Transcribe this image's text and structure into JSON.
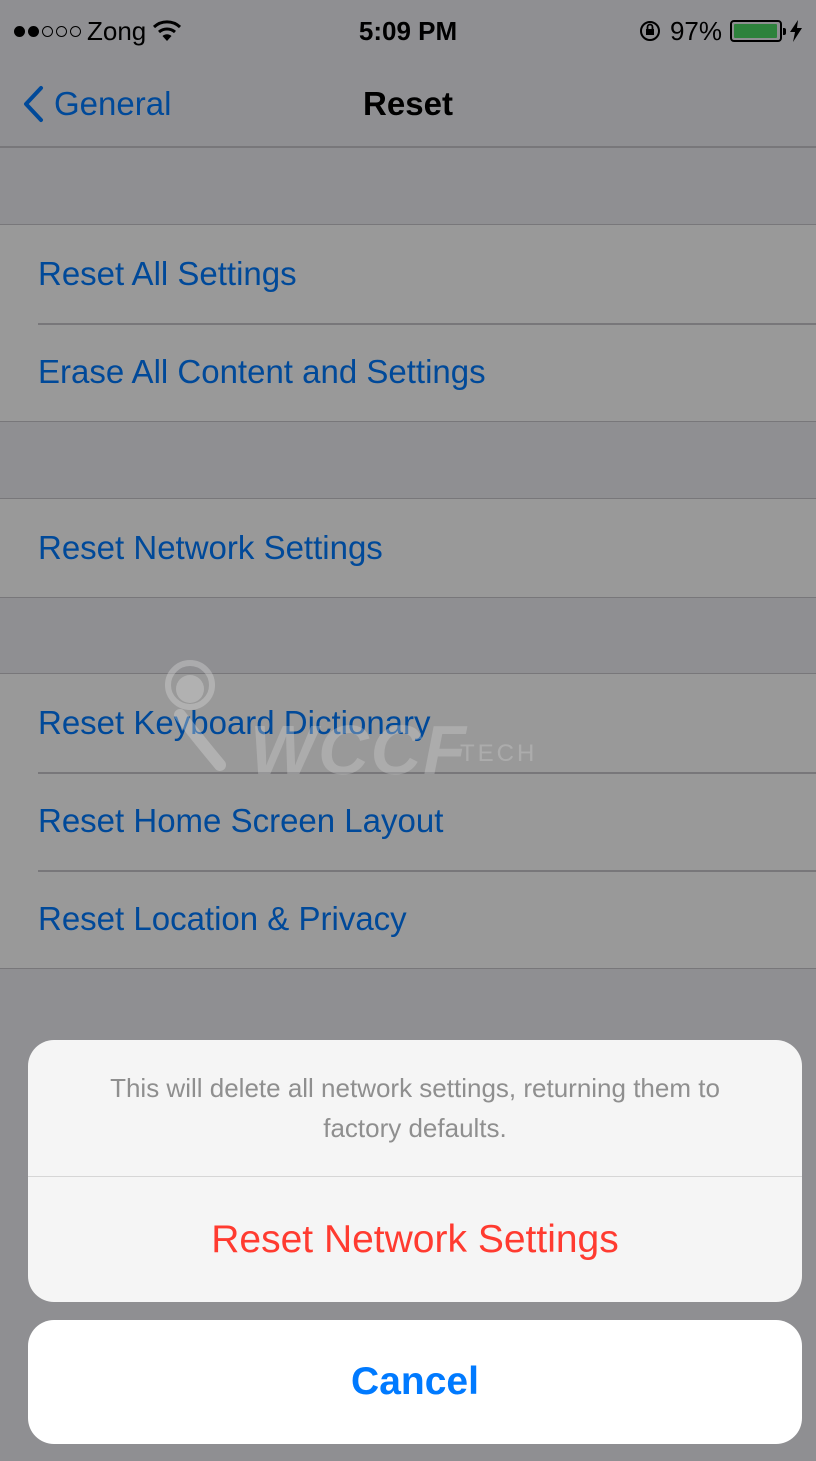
{
  "status_bar": {
    "carrier": "Zong",
    "time": "5:09 PM",
    "battery": "97%",
    "battery_level": 0.97,
    "icons": [
      "signal-dots-icon",
      "wifi-icon",
      "rotation-lock-icon",
      "battery-icon",
      "charging-bolt-icon"
    ]
  },
  "nav": {
    "back_label": "General",
    "title": "Reset"
  },
  "groups": [
    {
      "items": [
        "Reset All Settings",
        "Erase All Content and Settings"
      ]
    },
    {
      "items": [
        "Reset Network Settings"
      ]
    },
    {
      "items": [
        "Reset Keyboard Dictionary",
        "Reset Home Screen Layout",
        "Reset Location & Privacy"
      ]
    }
  ],
  "watermark": {
    "text": "WCCF",
    "sub": "TECH"
  },
  "action_sheet": {
    "message": "This will delete all network settings, returning them to factory defaults.",
    "destructive_label": "Reset Network Settings",
    "cancel_label": "Cancel"
  },
  "colors": {
    "accent": "#007aff",
    "destructive": "#ff3b30",
    "battery": "#4cd964"
  }
}
